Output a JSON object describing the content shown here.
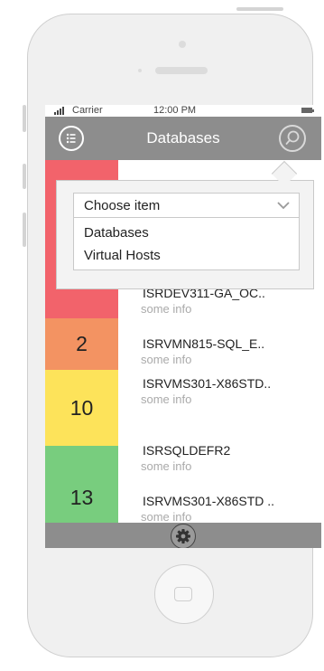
{
  "status_bar": {
    "carrier": "Carrier",
    "time": "12:00 PM"
  },
  "nav": {
    "title": "Databases"
  },
  "dropdown": {
    "selected_label": "Choose item",
    "options": [
      "Databases",
      "Virtual Hosts"
    ]
  },
  "rows": [
    {
      "count": "",
      "name": "ISRDEV311-GA_OC..",
      "info": "some info",
      "color": "#f2636b"
    },
    {
      "count": "2",
      "name": "ISRVMN815-SQL_E..",
      "info": "some info",
      "color": "#f39362"
    },
    {
      "count": "10",
      "name": "ISRVMS301-X86STD..",
      "info": "some info",
      "color": "#fde35a"
    },
    {
      "count": "",
      "name": "ISRSQLDEFR2",
      "info": "some info",
      "color": "#78cd7e"
    },
    {
      "count": "13",
      "name": "ISRVMS301-X86STD ..",
      "info": "some info",
      "color": "#78cd7e"
    }
  ],
  "icons": {
    "menu": "menu-list-icon",
    "search": "search-icon",
    "settings": "gear-icon",
    "chevron": "chevron-down-icon",
    "signal": "signal-icon",
    "battery": "battery-icon"
  },
  "colors": {
    "nav_bar": "#8d8d8d",
    "red": "#f2636b",
    "orange": "#f39362",
    "yellow": "#fde35a",
    "green": "#78cd7e"
  }
}
